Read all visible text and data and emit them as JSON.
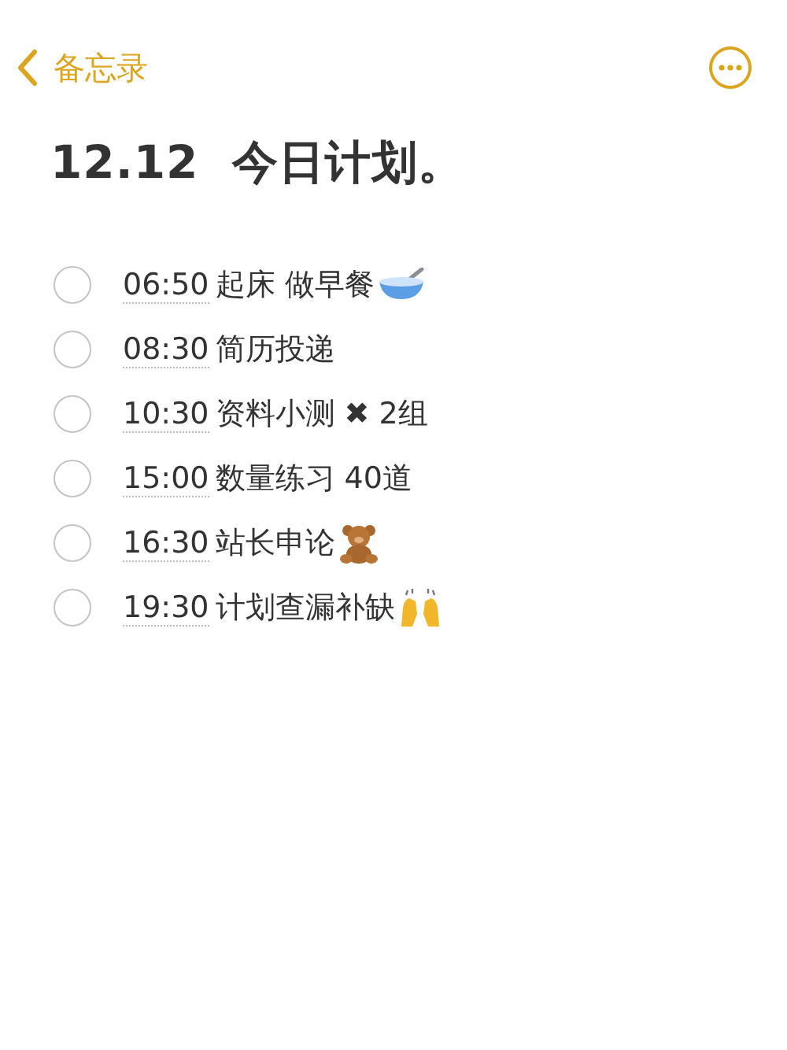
{
  "nav": {
    "back_label": "备忘录"
  },
  "title": "12.12  今日计划。",
  "checklist": [
    {
      "kind": "bowl",
      "time": "06:50",
      "text": "起床 做早餐",
      "checked": false
    },
    {
      "kind": "plain",
      "time": "08:30",
      "text": "简历投递",
      "checked": false
    },
    {
      "kind": "plain",
      "time": "10:30",
      "text": "资料小测 ✖ 2组",
      "checked": false
    },
    {
      "kind": "plain",
      "time": "15:00",
      "text": "数量练习 40道",
      "checked": false
    },
    {
      "kind": "bear",
      "time": "16:30",
      "text": "站长申论",
      "checked": false
    },
    {
      "kind": "hands",
      "time": "19:30",
      "text": "计划查漏补缺",
      "checked": false
    }
  ]
}
